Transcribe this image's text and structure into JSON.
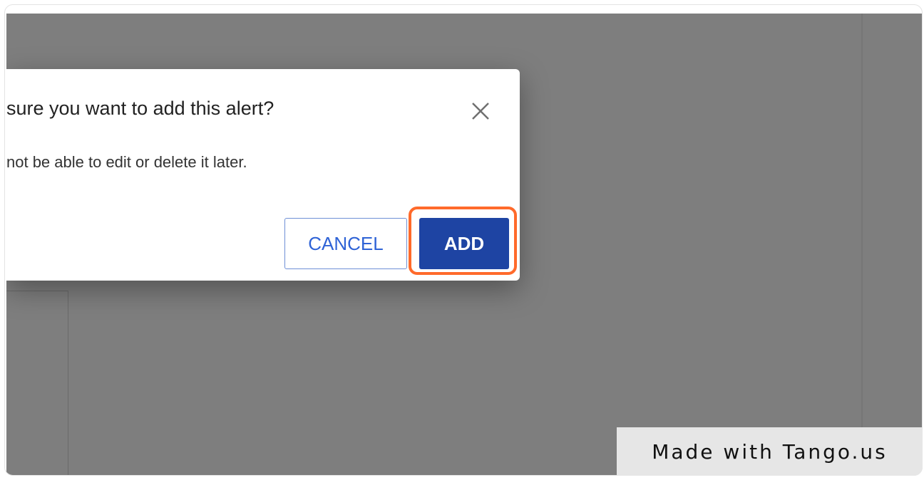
{
  "dialog": {
    "title": "sure you want to add this alert?",
    "body": "not be able to edit or delete it later.",
    "cancel_label": "CANCEL",
    "add_label": "ADD",
    "close_icon": "close-icon"
  },
  "watermark": {
    "text": "Made with Tango.us"
  },
  "colors": {
    "overlay": "#7e7e7e",
    "primary": "#1e44a3",
    "cancel_text": "#2f63d6",
    "highlight": "#ff6a2b"
  }
}
